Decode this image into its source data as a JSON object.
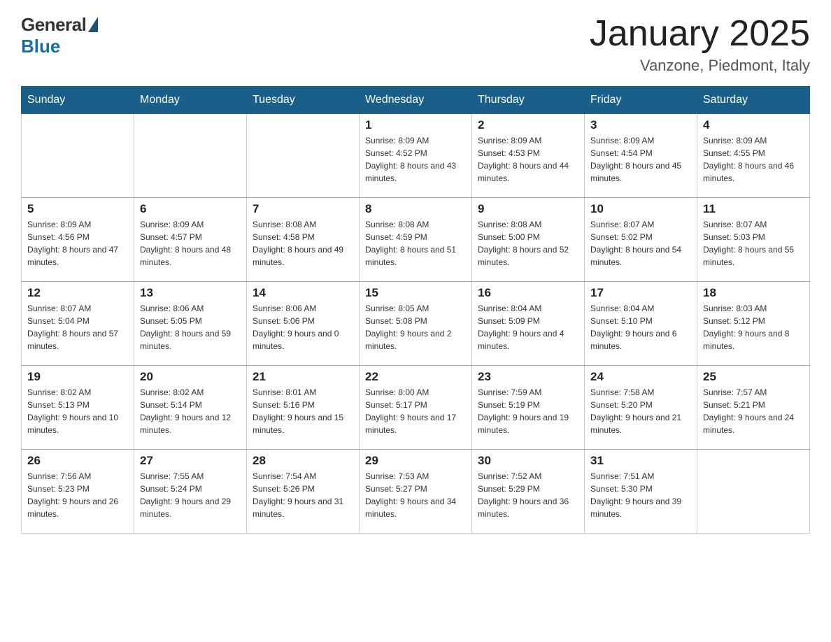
{
  "logo": {
    "general": "General",
    "blue": "Blue"
  },
  "header": {
    "title": "January 2025",
    "subtitle": "Vanzone, Piedmont, Italy"
  },
  "days_of_week": [
    "Sunday",
    "Monday",
    "Tuesday",
    "Wednesday",
    "Thursday",
    "Friday",
    "Saturday"
  ],
  "weeks": [
    [
      {
        "number": "",
        "sunrise": "",
        "sunset": "",
        "daylight": ""
      },
      {
        "number": "",
        "sunrise": "",
        "sunset": "",
        "daylight": ""
      },
      {
        "number": "",
        "sunrise": "",
        "sunset": "",
        "daylight": ""
      },
      {
        "number": "1",
        "sunrise": "Sunrise: 8:09 AM",
        "sunset": "Sunset: 4:52 PM",
        "daylight": "Daylight: 8 hours and 43 minutes."
      },
      {
        "number": "2",
        "sunrise": "Sunrise: 8:09 AM",
        "sunset": "Sunset: 4:53 PM",
        "daylight": "Daylight: 8 hours and 44 minutes."
      },
      {
        "number": "3",
        "sunrise": "Sunrise: 8:09 AM",
        "sunset": "Sunset: 4:54 PM",
        "daylight": "Daylight: 8 hours and 45 minutes."
      },
      {
        "number": "4",
        "sunrise": "Sunrise: 8:09 AM",
        "sunset": "Sunset: 4:55 PM",
        "daylight": "Daylight: 8 hours and 46 minutes."
      }
    ],
    [
      {
        "number": "5",
        "sunrise": "Sunrise: 8:09 AM",
        "sunset": "Sunset: 4:56 PM",
        "daylight": "Daylight: 8 hours and 47 minutes."
      },
      {
        "number": "6",
        "sunrise": "Sunrise: 8:09 AM",
        "sunset": "Sunset: 4:57 PM",
        "daylight": "Daylight: 8 hours and 48 minutes."
      },
      {
        "number": "7",
        "sunrise": "Sunrise: 8:08 AM",
        "sunset": "Sunset: 4:58 PM",
        "daylight": "Daylight: 8 hours and 49 minutes."
      },
      {
        "number": "8",
        "sunrise": "Sunrise: 8:08 AM",
        "sunset": "Sunset: 4:59 PM",
        "daylight": "Daylight: 8 hours and 51 minutes."
      },
      {
        "number": "9",
        "sunrise": "Sunrise: 8:08 AM",
        "sunset": "Sunset: 5:00 PM",
        "daylight": "Daylight: 8 hours and 52 minutes."
      },
      {
        "number": "10",
        "sunrise": "Sunrise: 8:07 AM",
        "sunset": "Sunset: 5:02 PM",
        "daylight": "Daylight: 8 hours and 54 minutes."
      },
      {
        "number": "11",
        "sunrise": "Sunrise: 8:07 AM",
        "sunset": "Sunset: 5:03 PM",
        "daylight": "Daylight: 8 hours and 55 minutes."
      }
    ],
    [
      {
        "number": "12",
        "sunrise": "Sunrise: 8:07 AM",
        "sunset": "Sunset: 5:04 PM",
        "daylight": "Daylight: 8 hours and 57 minutes."
      },
      {
        "number": "13",
        "sunrise": "Sunrise: 8:06 AM",
        "sunset": "Sunset: 5:05 PM",
        "daylight": "Daylight: 8 hours and 59 minutes."
      },
      {
        "number": "14",
        "sunrise": "Sunrise: 8:06 AM",
        "sunset": "Sunset: 5:06 PM",
        "daylight": "Daylight: 9 hours and 0 minutes."
      },
      {
        "number": "15",
        "sunrise": "Sunrise: 8:05 AM",
        "sunset": "Sunset: 5:08 PM",
        "daylight": "Daylight: 9 hours and 2 minutes."
      },
      {
        "number": "16",
        "sunrise": "Sunrise: 8:04 AM",
        "sunset": "Sunset: 5:09 PM",
        "daylight": "Daylight: 9 hours and 4 minutes."
      },
      {
        "number": "17",
        "sunrise": "Sunrise: 8:04 AM",
        "sunset": "Sunset: 5:10 PM",
        "daylight": "Daylight: 9 hours and 6 minutes."
      },
      {
        "number": "18",
        "sunrise": "Sunrise: 8:03 AM",
        "sunset": "Sunset: 5:12 PM",
        "daylight": "Daylight: 9 hours and 8 minutes."
      }
    ],
    [
      {
        "number": "19",
        "sunrise": "Sunrise: 8:02 AM",
        "sunset": "Sunset: 5:13 PM",
        "daylight": "Daylight: 9 hours and 10 minutes."
      },
      {
        "number": "20",
        "sunrise": "Sunrise: 8:02 AM",
        "sunset": "Sunset: 5:14 PM",
        "daylight": "Daylight: 9 hours and 12 minutes."
      },
      {
        "number": "21",
        "sunrise": "Sunrise: 8:01 AM",
        "sunset": "Sunset: 5:16 PM",
        "daylight": "Daylight: 9 hours and 15 minutes."
      },
      {
        "number": "22",
        "sunrise": "Sunrise: 8:00 AM",
        "sunset": "Sunset: 5:17 PM",
        "daylight": "Daylight: 9 hours and 17 minutes."
      },
      {
        "number": "23",
        "sunrise": "Sunrise: 7:59 AM",
        "sunset": "Sunset: 5:19 PM",
        "daylight": "Daylight: 9 hours and 19 minutes."
      },
      {
        "number": "24",
        "sunrise": "Sunrise: 7:58 AM",
        "sunset": "Sunset: 5:20 PM",
        "daylight": "Daylight: 9 hours and 21 minutes."
      },
      {
        "number": "25",
        "sunrise": "Sunrise: 7:57 AM",
        "sunset": "Sunset: 5:21 PM",
        "daylight": "Daylight: 9 hours and 24 minutes."
      }
    ],
    [
      {
        "number": "26",
        "sunrise": "Sunrise: 7:56 AM",
        "sunset": "Sunset: 5:23 PM",
        "daylight": "Daylight: 9 hours and 26 minutes."
      },
      {
        "number": "27",
        "sunrise": "Sunrise: 7:55 AM",
        "sunset": "Sunset: 5:24 PM",
        "daylight": "Daylight: 9 hours and 29 minutes."
      },
      {
        "number": "28",
        "sunrise": "Sunrise: 7:54 AM",
        "sunset": "Sunset: 5:26 PM",
        "daylight": "Daylight: 9 hours and 31 minutes."
      },
      {
        "number": "29",
        "sunrise": "Sunrise: 7:53 AM",
        "sunset": "Sunset: 5:27 PM",
        "daylight": "Daylight: 9 hours and 34 minutes."
      },
      {
        "number": "30",
        "sunrise": "Sunrise: 7:52 AM",
        "sunset": "Sunset: 5:29 PM",
        "daylight": "Daylight: 9 hours and 36 minutes."
      },
      {
        "number": "31",
        "sunrise": "Sunrise: 7:51 AM",
        "sunset": "Sunset: 5:30 PM",
        "daylight": "Daylight: 9 hours and 39 minutes."
      },
      {
        "number": "",
        "sunrise": "",
        "sunset": "",
        "daylight": ""
      }
    ]
  ]
}
